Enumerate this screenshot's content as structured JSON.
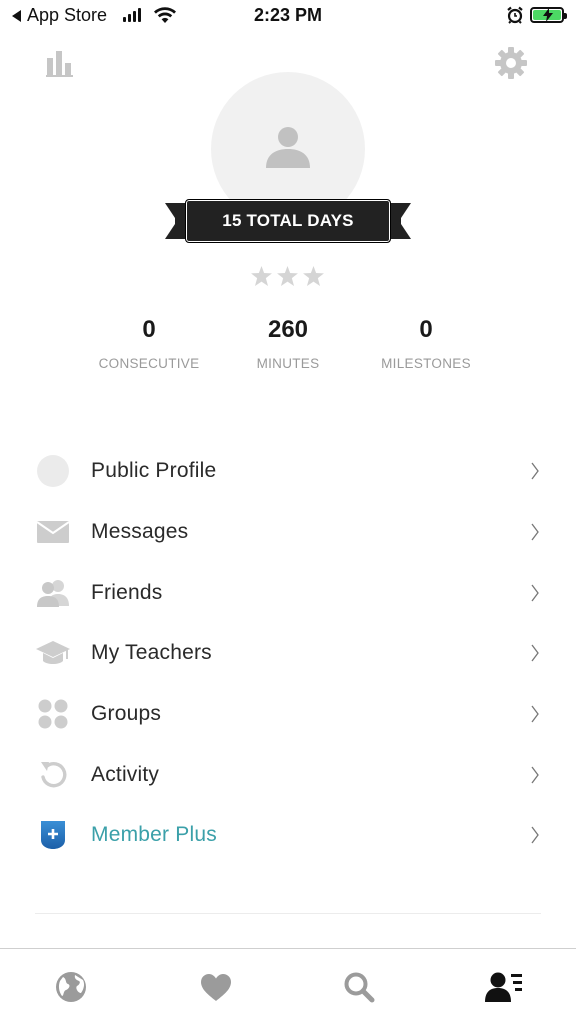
{
  "status_bar": {
    "back_label": "App Store",
    "time": "2:23 PM"
  },
  "profile": {
    "ribbon_text": "15 TOTAL DAYS",
    "stars_filled": 0,
    "stars_total": 3,
    "stats": [
      {
        "value": "0",
        "label": "CONSECUTIVE"
      },
      {
        "value": "260",
        "label": "MINUTES"
      },
      {
        "value": "0",
        "label": "MILESTONES"
      }
    ]
  },
  "menu": {
    "items": [
      {
        "label": "Public Profile",
        "icon": "profile-circle-icon"
      },
      {
        "label": "Messages",
        "icon": "envelope-icon"
      },
      {
        "label": "Friends",
        "icon": "friends-icon"
      },
      {
        "label": "My Teachers",
        "icon": "graduation-cap-icon"
      },
      {
        "label": "Groups",
        "icon": "groups-icon"
      },
      {
        "label": "Activity",
        "icon": "activity-icon"
      },
      {
        "label": "Member Plus",
        "icon": "member-plus-icon"
      }
    ]
  },
  "tabs": [
    {
      "icon": "globe-icon"
    },
    {
      "icon": "heart-icon"
    },
    {
      "icon": "search-icon"
    },
    {
      "icon": "profile-list-icon",
      "active": true
    }
  ],
  "colors": {
    "accent": "#3ba0a9",
    "icon_gray": "#c9c9c9",
    "ribbon": "#222222",
    "battery": "#4cd964"
  }
}
